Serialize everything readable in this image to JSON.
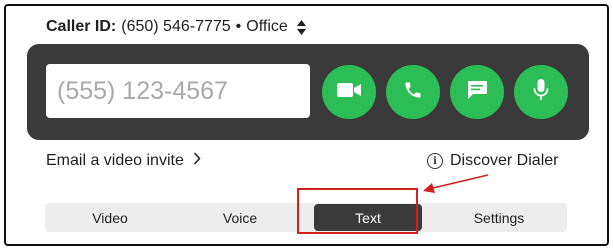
{
  "caller_id": {
    "label": "Caller ID:",
    "number": "(650) 546-7775",
    "separator": "•",
    "line": "Office"
  },
  "dialer": {
    "placeholder": "(555) 123-4567",
    "value": "",
    "buttons": [
      {
        "name": "video-call-button",
        "icon": "video-camera-icon"
      },
      {
        "name": "voice-call-button",
        "icon": "phone-icon"
      },
      {
        "name": "message-button",
        "icon": "chat-bubble-icon"
      },
      {
        "name": "voice-input-button",
        "icon": "microphone-icon"
      }
    ],
    "accent": "#2dbd55",
    "bar_color": "#3a3a3a"
  },
  "links": {
    "invite_label": "Email a video invite",
    "discover_label": "Discover Dialer"
  },
  "tabs": {
    "items": [
      {
        "label": "Video"
      },
      {
        "label": "Voice"
      },
      {
        "label": "Text"
      },
      {
        "label": "Settings"
      }
    ],
    "selected": "Text"
  },
  "annotation": {
    "color": "#d21f1f"
  }
}
